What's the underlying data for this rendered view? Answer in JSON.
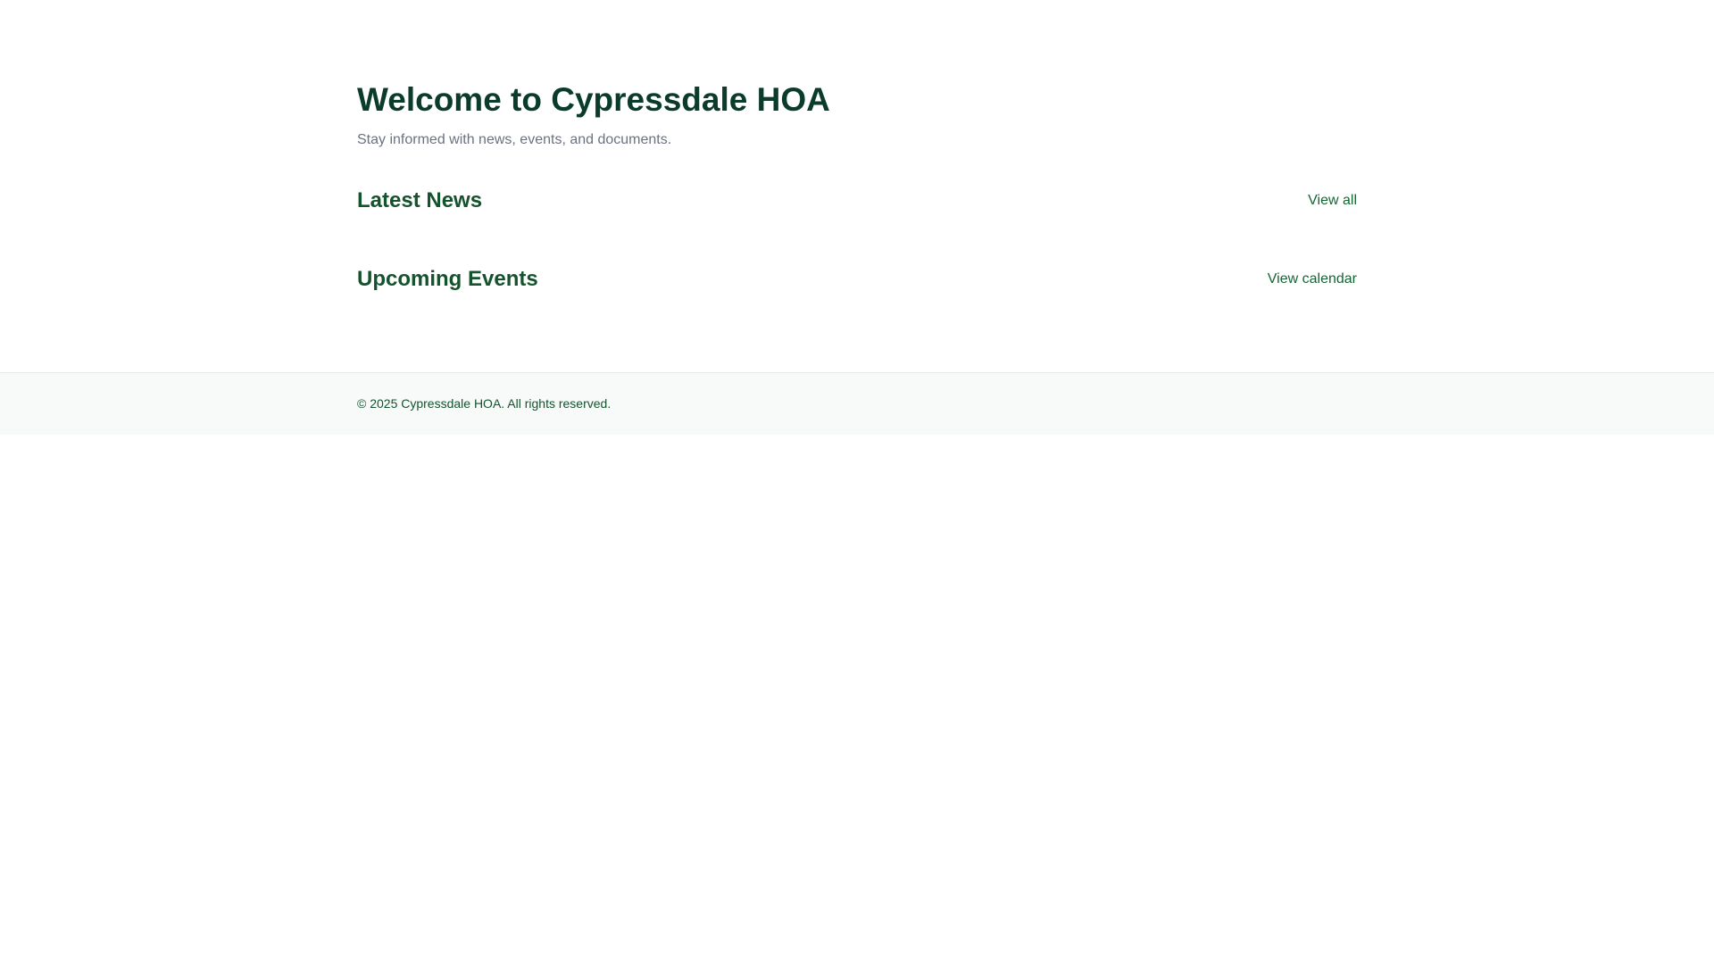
{
  "hero": {
    "title": "Welcome to Cypressdale HOA",
    "subtitle": "Stay informed with news, events, and documents."
  },
  "sections": {
    "news": {
      "title": "Latest News",
      "link_label": "View all"
    },
    "events": {
      "title": "Upcoming Events",
      "link_label": "View calendar"
    }
  },
  "footer": {
    "copyright": "© 2025 Cypressdale HOA. All rights reserved."
  },
  "colors": {
    "heading": "#0b3b2a",
    "accent": "#166534",
    "muted_text": "#6b7280",
    "footer_background": "#f7faf9"
  }
}
